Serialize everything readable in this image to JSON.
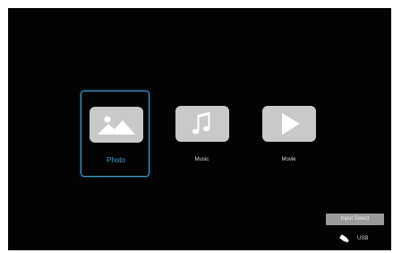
{
  "menu": {
    "items": [
      {
        "label": "Photo",
        "icon": "photo-icon",
        "selected": true
      },
      {
        "label": "Music",
        "icon": "music-note-icon",
        "selected": false
      },
      {
        "label": "Movie",
        "icon": "play-icon",
        "selected": false
      }
    ]
  },
  "footer": {
    "input_select_label": "Input Select",
    "source_label": "USB",
    "source_icon": "usb-stick-icon"
  },
  "colors": {
    "background": "#030303",
    "selection_accent": "#3fa7d6",
    "icon_tile": "#c9c9c9",
    "button_gray": "#9a9a9a"
  }
}
